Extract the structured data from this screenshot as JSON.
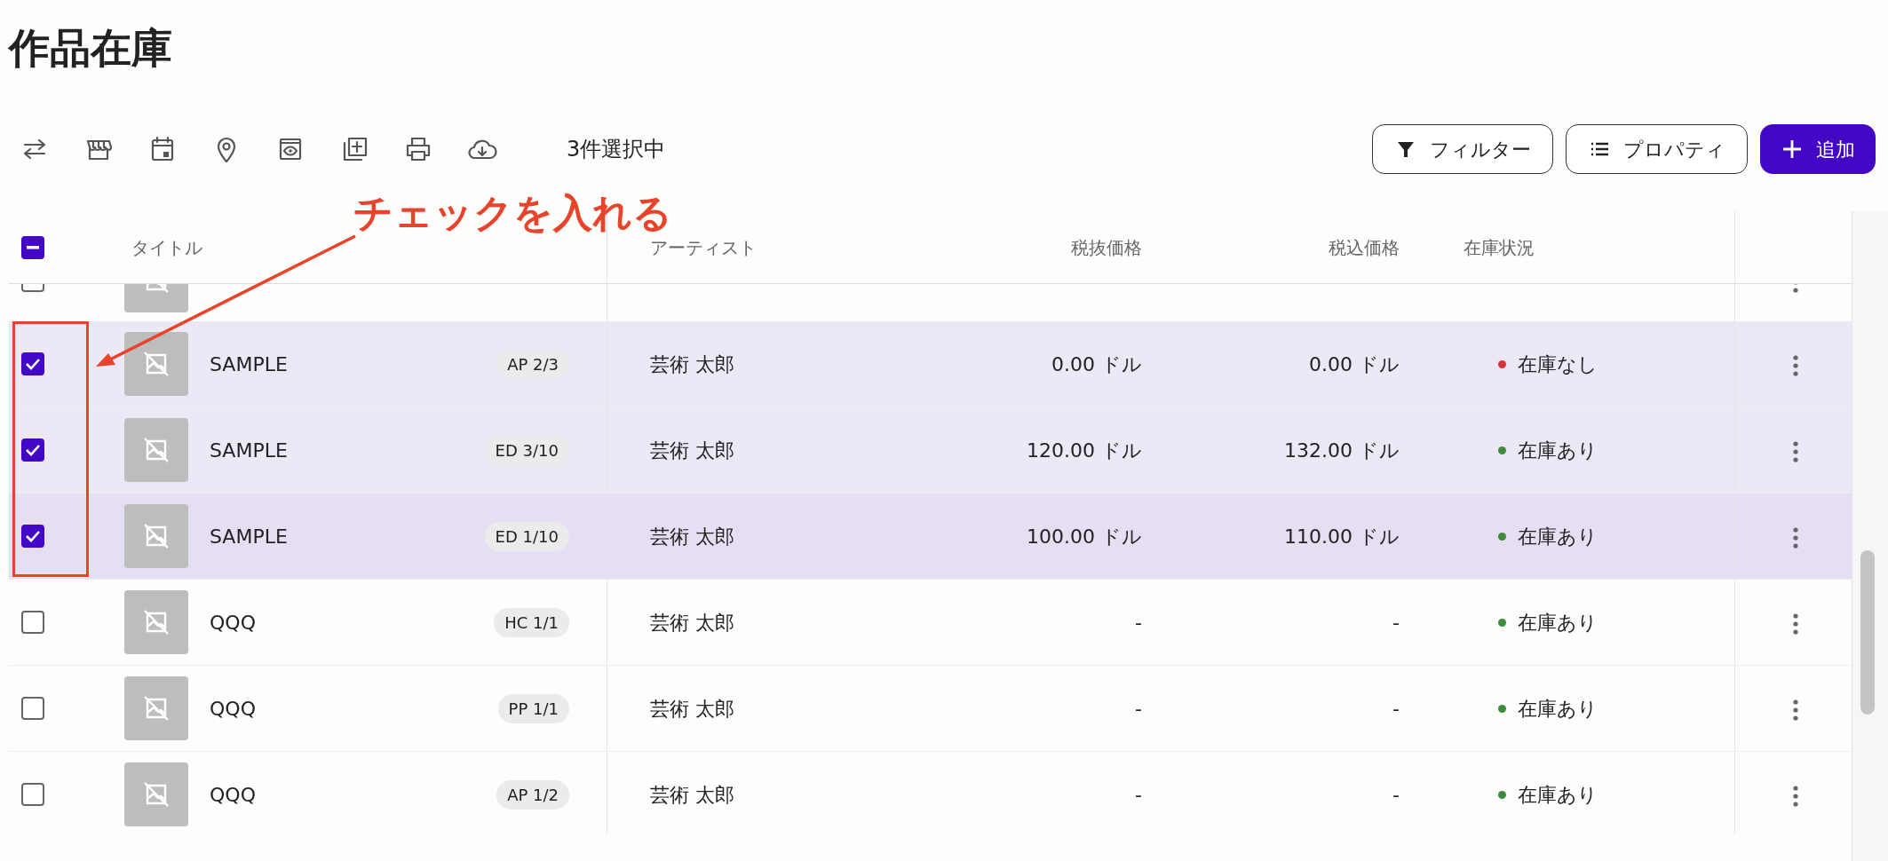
{
  "page_title": "作品在庫",
  "toolbar": {
    "selection_count": "3件選択中",
    "buttons": [
      {
        "label": "フィルター",
        "kind": "filter"
      },
      {
        "label": "プロパティ",
        "kind": "properties"
      },
      {
        "label": "追加",
        "kind": "add"
      }
    ]
  },
  "annotation": {
    "text": "チェックを入れる"
  },
  "table": {
    "select_all": {
      "indeterminate": true
    },
    "columns": [
      "タイトル",
      "アーティスト",
      "税抜価格",
      "税込価格",
      "在庫状況"
    ],
    "partial_top_row": {
      "checked": false
    },
    "rows": [
      {
        "checked": true,
        "highlighted": false,
        "title": "SAMPLE",
        "edition": "AP 2/3",
        "artist": "芸術 太郎",
        "price_excl": "0.00 ドル",
        "price_incl": "0.00 ドル",
        "status": "在庫なし",
        "color": "#d9343b"
      },
      {
        "checked": true,
        "highlighted": false,
        "title": "SAMPLE",
        "edition": "ED 3/10",
        "artist": "芸術 太郎",
        "price_excl": "120.00 ドル",
        "price_incl": "132.00 ドル",
        "status": "在庫あり",
        "color": "#3f8a3c"
      },
      {
        "checked": true,
        "highlighted": true,
        "title": "SAMPLE",
        "edition": "ED 1/10",
        "artist": "芸術 太郎",
        "price_excl": "100.00 ドル",
        "price_incl": "110.00 ドル",
        "status": "在庫あり",
        "color": "#3f8a3c"
      },
      {
        "checked": false,
        "highlighted": false,
        "title": "QQQ",
        "edition": "HC 1/1",
        "artist": "芸術 太郎",
        "price_excl": "-",
        "price_incl": "-",
        "status": "在庫あり",
        "color": "#3f8a3c"
      },
      {
        "checked": false,
        "highlighted": false,
        "title": "QQQ",
        "edition": "PP 1/1",
        "artist": "芸術 太郎",
        "price_excl": "-",
        "price_incl": "-",
        "status": "在庫あり",
        "color": "#3f8a3c"
      },
      {
        "checked": false,
        "highlighted": false,
        "title": "QQQ",
        "edition": "AP 1/2",
        "artist": "芸術 太郎",
        "price_excl": "-",
        "price_incl": "-",
        "status": "在庫あり",
        "color": "#3f8a3c"
      }
    ]
  }
}
